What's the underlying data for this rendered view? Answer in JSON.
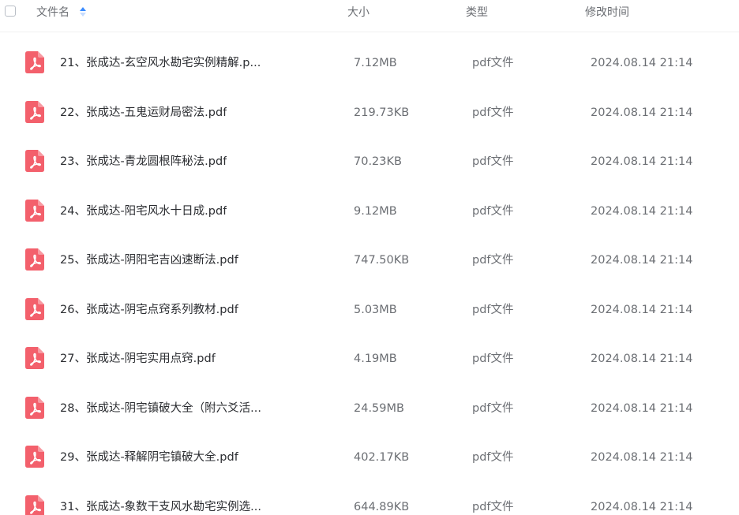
{
  "header": {
    "name": "文件名",
    "size": "大小",
    "type": "类型",
    "time": "修改时间"
  },
  "colors": {
    "pdf_icon": "#f3606c",
    "sort_active": "#3b8cff",
    "sort_inactive": "#c7dcff"
  },
  "icons": {
    "file": "pdf-file-icon",
    "sort": "sort-ascending-icon"
  },
  "files": [
    {
      "name": "21、张成达-玄空风水勘宅实例精解.p...",
      "size": "7.12MB",
      "type": "pdf文件",
      "time": "2024.08.14 21:14"
    },
    {
      "name": "22、张成达-五鬼运财局密法.pdf",
      "size": "219.73KB",
      "type": "pdf文件",
      "time": "2024.08.14 21:14"
    },
    {
      "name": "23、张成达-青龙圆根阵秘法.pdf",
      "size": "70.23KB",
      "type": "pdf文件",
      "time": "2024.08.14 21:14"
    },
    {
      "name": "24、张成达-阳宅风水十日成.pdf",
      "size": "9.12MB",
      "type": "pdf文件",
      "time": "2024.08.14 21:14"
    },
    {
      "name": "25、张成达-阴阳宅吉凶速断法.pdf",
      "size": "747.50KB",
      "type": "pdf文件",
      "time": "2024.08.14 21:14"
    },
    {
      "name": "26、张成达-阴宅点窍系列教材.pdf",
      "size": "5.03MB",
      "type": "pdf文件",
      "time": "2024.08.14 21:14"
    },
    {
      "name": "27、张成达-阴宅实用点窍.pdf",
      "size": "4.19MB",
      "type": "pdf文件",
      "time": "2024.08.14 21:14"
    },
    {
      "name": "28、张成达-阴宅镇破大全（附六爻活...",
      "size": "24.59MB",
      "type": "pdf文件",
      "time": "2024.08.14 21:14"
    },
    {
      "name": "29、张成达-释解阴宅镇破大全.pdf",
      "size": "402.17KB",
      "type": "pdf文件",
      "time": "2024.08.14 21:14"
    },
    {
      "name": "31、张成达-象数干支风水勘宅实例选...",
      "size": "644.89KB",
      "type": "pdf文件",
      "time": "2024.08.14 21:14"
    }
  ]
}
